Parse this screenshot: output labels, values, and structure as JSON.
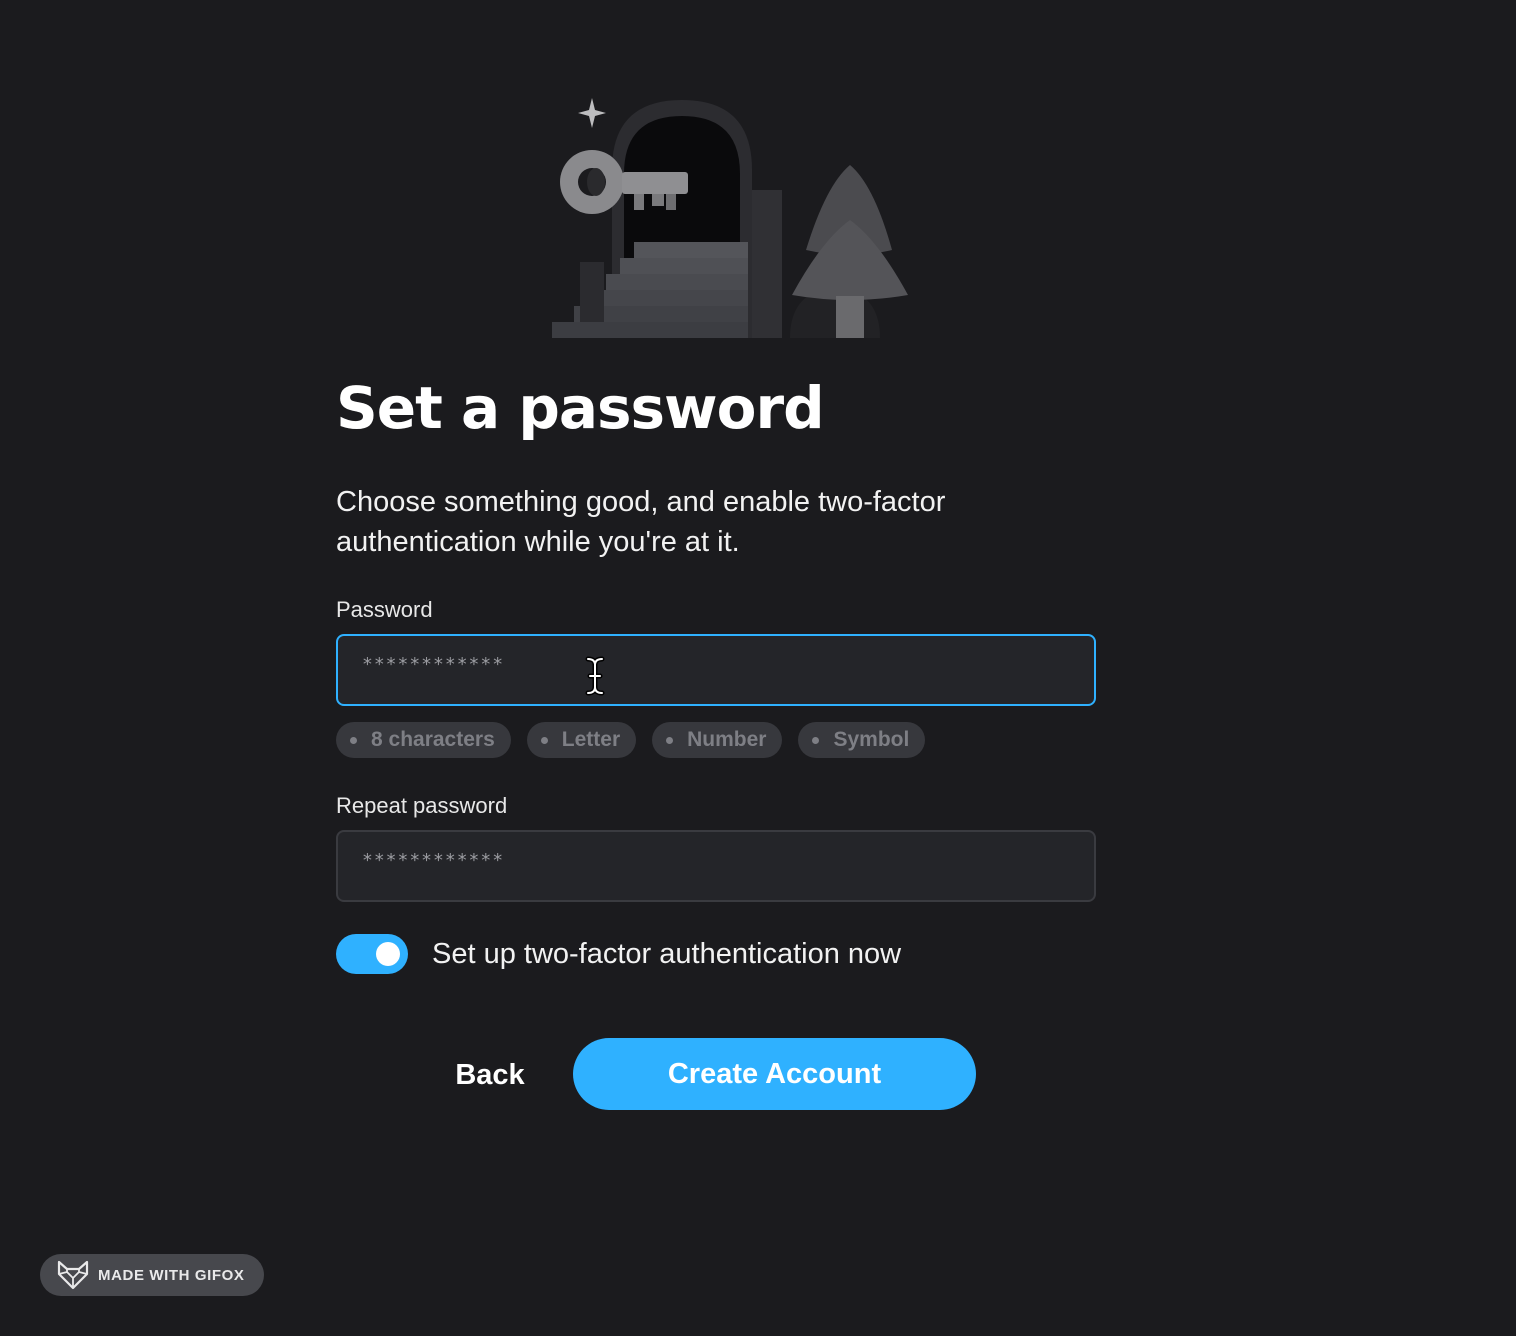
{
  "heading": {
    "title": "Set a password",
    "subtitle": "Choose something good, and enable two-factor authentication while you're at it."
  },
  "password": {
    "label": "Password",
    "value": "************",
    "state": "focused"
  },
  "requirements": [
    {
      "label": "8 characters"
    },
    {
      "label": "Letter"
    },
    {
      "label": "Number"
    },
    {
      "label": "Symbol"
    }
  ],
  "repeat_password": {
    "label": "Repeat password",
    "value": "************"
  },
  "two_factor": {
    "label": "Set up two-factor authentication now",
    "enabled": true
  },
  "actions": {
    "back_label": "Back",
    "create_label": "Create Account"
  },
  "badge": {
    "text": "MADE WITH GIFOX",
    "icon": "fox-icon"
  },
  "colors": {
    "background": "#1b1b1e",
    "accent": "#2fb1ff",
    "input_bg": "#242529",
    "chip_bg": "#37383d",
    "chip_text": "#7e7f85"
  },
  "illustration": {
    "icons": [
      "key-icon",
      "door-icon",
      "stairs-icon",
      "tree-icon",
      "sparkle-icon"
    ]
  }
}
